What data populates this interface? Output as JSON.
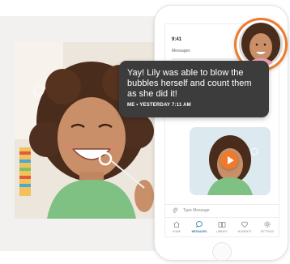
{
  "phone": {
    "status_time": "9:41",
    "header_label": "Messages",
    "compose_placeholder": "Type Message",
    "tabs": [
      {
        "label": "HOME",
        "icon": "home-icon",
        "active": false
      },
      {
        "label": "MESSAGES",
        "icon": "chat-icon",
        "active": true
      },
      {
        "label": "LIBRARY",
        "icon": "book-icon",
        "active": false
      },
      {
        "label": "MOMENTS",
        "icon": "heart-icon",
        "active": false
      },
      {
        "label": "SETTINGS",
        "icon": "gear-icon",
        "active": false
      }
    ]
  },
  "message": {
    "text": "Yay! Lily was able to blow the bubbles herself and count them as she did it!",
    "meta": "ME • YESTERDAY 7:11 AM"
  },
  "colors": {
    "accent": "#f07a2a",
    "bubble_bg": "#3c3c3c",
    "tab_active": "#2b7aa0"
  }
}
